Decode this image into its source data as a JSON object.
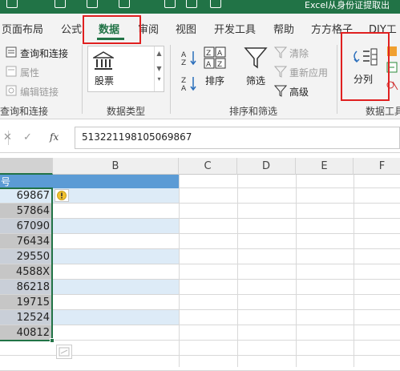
{
  "title_bar": {
    "title": "Excel从身份证提取出"
  },
  "tabs": [
    {
      "label": "页面布局"
    },
    {
      "label": "公式"
    },
    {
      "label": "数据"
    },
    {
      "label": "审阅"
    },
    {
      "label": "视图"
    },
    {
      "label": "开发工具"
    },
    {
      "label": "帮助"
    },
    {
      "label": "方方格子"
    },
    {
      "label": "DIY工"
    }
  ],
  "ribbon": {
    "get_data": {
      "query_connections": "查询和连接",
      "properties": "属性",
      "edit_links": "编辑链接",
      "group_label": "查询和连接"
    },
    "data_types": {
      "stocks": "股票",
      "group_label": "数据类型"
    },
    "sort_filter": {
      "sort": "排序",
      "filter": "筛选",
      "clear": "清除",
      "reapply": "重新应用",
      "advanced": "高级",
      "group_label": "排序和筛选"
    },
    "data_tools": {
      "text_to_columns": "分列",
      "group_label": "数据工具"
    }
  },
  "formula_bar": {
    "cancel_glyph": "✕",
    "enter_glyph": "✓",
    "fx_label": "fx",
    "value": "513221198105069867"
  },
  "grid": {
    "column_a_header_partial": "号",
    "columns": [
      "B",
      "C",
      "D",
      "E",
      "F"
    ],
    "cells_a": [
      "69867",
      "57864",
      "67090",
      "76434",
      "29550",
      "4588X",
      "86218",
      "19715",
      "12524",
      "40812"
    ]
  },
  "colors": {
    "excel_green": "#217346",
    "header_blue": "#5b9bd5",
    "row_light_blue": "#ddebf7",
    "selection_gray": "#c6c6c6",
    "highlight_red": "#e02020"
  }
}
